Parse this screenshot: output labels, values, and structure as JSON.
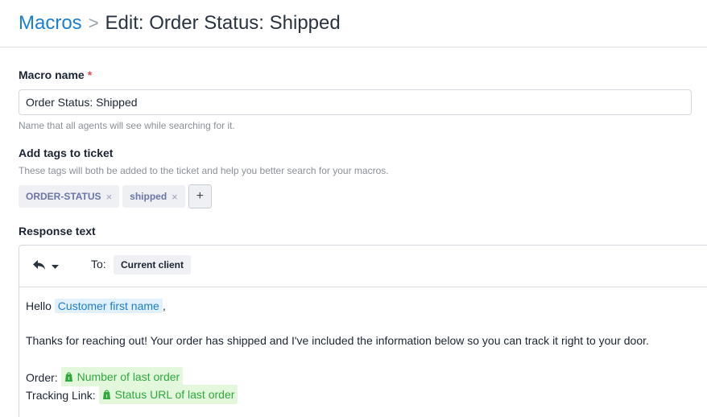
{
  "breadcrumb": {
    "root": "Macros",
    "separator": ">",
    "current": "Edit: Order Status: Shipped"
  },
  "form": {
    "macro_name": {
      "label": "Macro name",
      "required_mark": "*",
      "value": "Order Status: Shipped",
      "help": "Name that all agents will see while searching for it."
    },
    "tags": {
      "label": "Add tags to ticket",
      "help": "These tags will both be added to the ticket and help you better search for your macros.",
      "items": [
        {
          "label": "ORDER-STATUS",
          "remove": "×"
        },
        {
          "label": "shipped",
          "remove": "×"
        }
      ],
      "add_label": "+"
    },
    "response": {
      "label": "Response text",
      "toolbar": {
        "reply_icon": "reply-icon",
        "dropdown_icon": "caret-down-icon",
        "to_label": "To:",
        "to_value": "Current client"
      },
      "body": {
        "greeting": "Hello",
        "greeting_variable": "Customer first name",
        "greeting_suffix": ",",
        "paragraph": "Thanks for reaching out! Your order has shipped and I've included the information below so you can track it right to your door.",
        "order_label": "Order:",
        "order_variable": "Number of last order",
        "tracking_label": "Tracking Link:",
        "tracking_variable": "Status URL of last order",
        "variable_icon": "shopify-bag-icon"
      }
    }
  },
  "colors": {
    "link": "#1a7fd4",
    "required": "#e5484d",
    "variable_blue_bg": "#e2f0fc",
    "variable_green_bg": "#e3f7dc",
    "variable_green_text": "#2eaa3d",
    "tag_text": "#6b75a8"
  }
}
